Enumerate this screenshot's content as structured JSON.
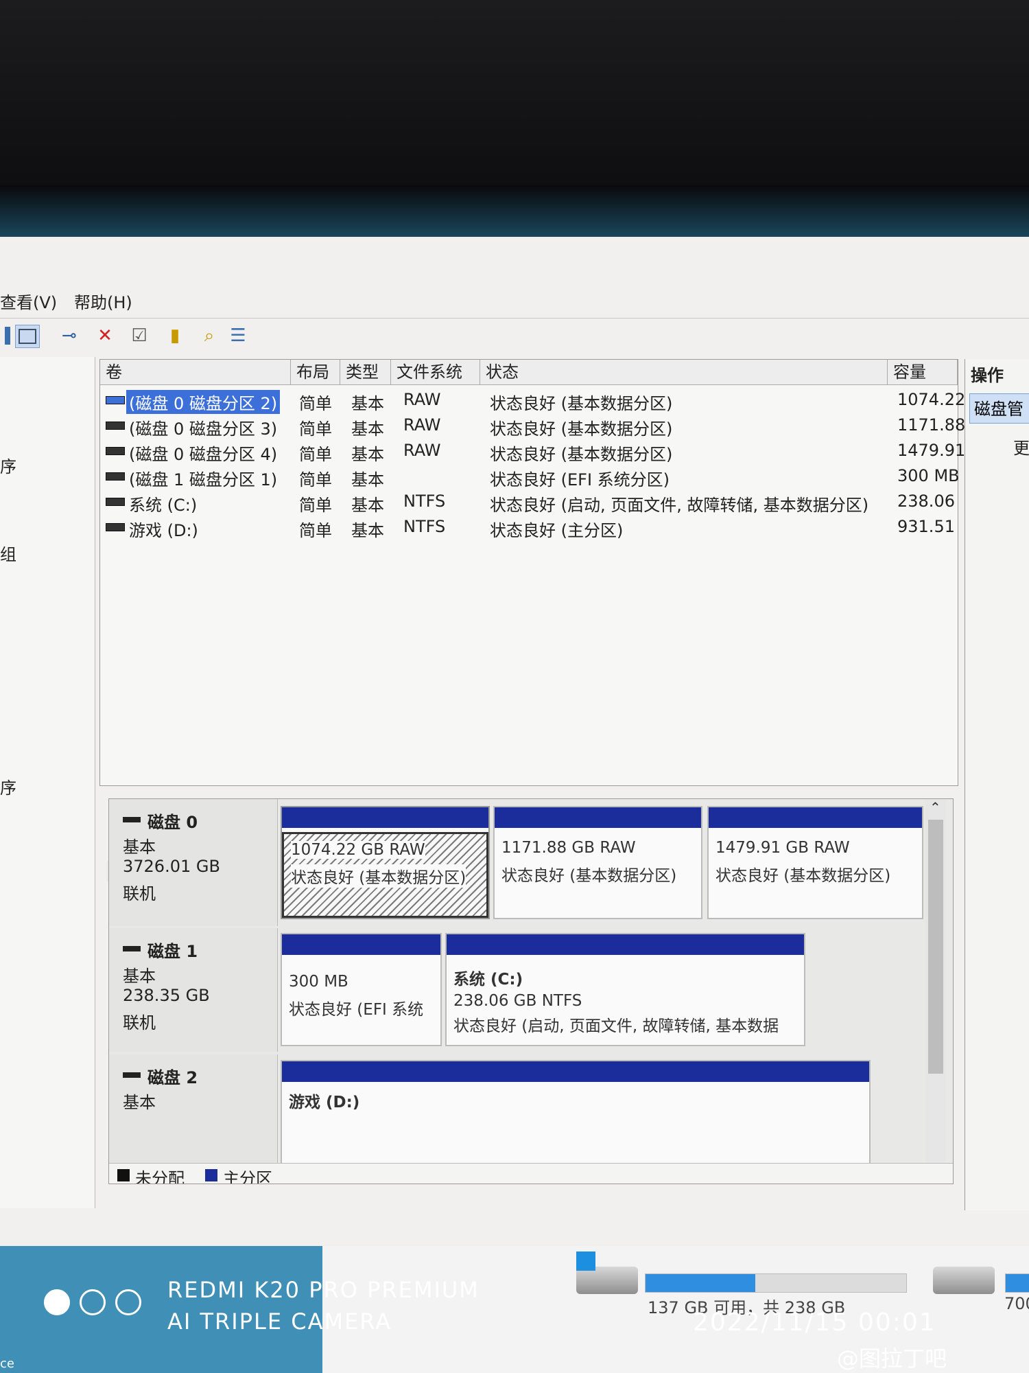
{
  "menu": {
    "view": "查看(V)",
    "help": "帮助(H)"
  },
  "toolbar": {
    "items": [
      "console-tree-icon",
      "connect-icon",
      "delete-icon",
      "properties-icon",
      "help-icon",
      "search-icon",
      "list-icon"
    ]
  },
  "left_nav": {
    "items": [
      "序",
      "组",
      "序"
    ]
  },
  "volume_list": {
    "columns": [
      "卷",
      "布局",
      "类型",
      "文件系统",
      "状态",
      "容量"
    ],
    "rows": [
      {
        "volume": "(磁盘 0 磁盘分区 2)",
        "layout": "简单",
        "type": "基本",
        "fs": "RAW",
        "status": "状态良好 (基本数据分区)",
        "capacity": "1074.22"
      },
      {
        "volume": "(磁盘 0 磁盘分区 3)",
        "layout": "简单",
        "type": "基本",
        "fs": "RAW",
        "status": "状态良好 (基本数据分区)",
        "capacity": "1171.88"
      },
      {
        "volume": "(磁盘 0 磁盘分区 4)",
        "layout": "简单",
        "type": "基本",
        "fs": "RAW",
        "status": "状态良好 (基本数据分区)",
        "capacity": "1479.91"
      },
      {
        "volume": "(磁盘 1 磁盘分区 1)",
        "layout": "简单",
        "type": "基本",
        "fs": "",
        "status": "状态良好 (EFI 系统分区)",
        "capacity": "300 MB"
      },
      {
        "volume": "系统 (C:)",
        "layout": "简单",
        "type": "基本",
        "fs": "NTFS",
        "status": "状态良好 (启动, 页面文件, 故障转储, 基本数据分区)",
        "capacity": "238.06"
      },
      {
        "volume": "游戏 (D:)",
        "layout": "简单",
        "type": "基本",
        "fs": "NTFS",
        "status": "状态良好 (主分区)",
        "capacity": "931.51"
      }
    ]
  },
  "disks": [
    {
      "name": "磁盘 0",
      "type": "基本",
      "size": "3726.01 GB",
      "state": "联机",
      "partitions": [
        {
          "title": "",
          "size": "1074.22 GB RAW",
          "status": "状态良好 (基本数据分区)"
        },
        {
          "title": "",
          "size": "1171.88 GB RAW",
          "status": "状态良好 (基本数据分区)"
        },
        {
          "title": "",
          "size": "1479.91 GB RAW",
          "status": "状态良好 (基本数据分区)"
        }
      ]
    },
    {
      "name": "磁盘 1",
      "type": "基本",
      "size": "238.35 GB",
      "state": "联机",
      "partitions": [
        {
          "title": "",
          "size": "300 MB",
          "status": "状态良好 (EFI 系统"
        },
        {
          "title": "系统 (C:)",
          "size": "238.06 GB NTFS",
          "status": "状态良好 (启动, 页面文件, 故障转储, 基本数据"
        }
      ]
    },
    {
      "name": "磁盘 2",
      "type": "基本",
      "size": "",
      "state": "",
      "partitions": [
        {
          "title": "游戏 (D:)",
          "size": "",
          "status": ""
        }
      ]
    }
  ],
  "legend": {
    "unallocated": "未分配",
    "primary": "主分区",
    "unallocated_color": "#111111",
    "primary_color": "#1a2d9a"
  },
  "actions": {
    "header": "操作",
    "selected": "磁盘管",
    "more": "更"
  },
  "explorer": {
    "drive_c_text": "137 GB 可用，共 238 GB",
    "drive_c_fill": 0.42,
    "drive_d_partial": "700"
  },
  "watermark": {
    "line1": "REDMI K20 PRO PREMIUM",
    "line2": "AI TRIPLE CAMERA",
    "datetime": "2022/11/15  00:01",
    "source": "@图拉丁吧",
    "corner": "ce"
  }
}
